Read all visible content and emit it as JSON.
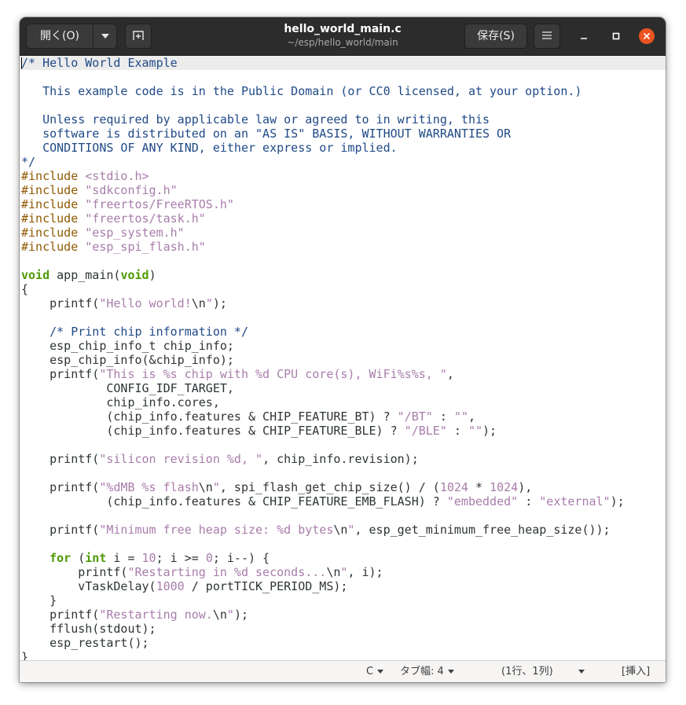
{
  "header": {
    "open_label": "開く(O)",
    "title": "hello_world_main.c",
    "subtitle": "~/esp/hello_world/main",
    "save_label": "保存(S)",
    "colors": {
      "bar": "#2c2c2c",
      "close": "#e95420"
    }
  },
  "editor": {
    "language_colors": {
      "comment": "#204a87",
      "preprocessor": "#8f5902",
      "string": "#a87dab",
      "keyword": "#4e9a06"
    },
    "lines": [
      "/* Hello World Example",
      "",
      "   This example code is in the Public Domain (or CC0 licensed, at your option.)",
      "",
      "   Unless required by applicable law or agreed to in writing, this",
      "   software is distributed on an \"AS IS\" BASIS, WITHOUT WARRANTIES OR",
      "   CONDITIONS OF ANY KIND, either express or implied.",
      "*/",
      "#include <stdio.h>",
      "#include \"sdkconfig.h\"",
      "#include \"freertos/FreeRTOS.h\"",
      "#include \"freertos/task.h\"",
      "#include \"esp_system.h\"",
      "#include \"esp_spi_flash.h\"",
      "",
      "void app_main(void)",
      "{",
      "    printf(\"Hello world!\\n\");",
      "",
      "    /* Print chip information */",
      "    esp_chip_info_t chip_info;",
      "    esp_chip_info(&chip_info);",
      "    printf(\"This is %s chip with %d CPU core(s), WiFi%s%s, \",",
      "            CONFIG_IDF_TARGET,",
      "            chip_info.cores,",
      "            (chip_info.features & CHIP_FEATURE_BT) ? \"/BT\" : \"\",",
      "            (chip_info.features & CHIP_FEATURE_BLE) ? \"/BLE\" : \"\");",
      "",
      "    printf(\"silicon revision %d, \", chip_info.revision);",
      "",
      "    printf(\"%dMB %s flash\\n\", spi_flash_get_chip_size() / (1024 * 1024),",
      "            (chip_info.features & CHIP_FEATURE_EMB_FLASH) ? \"embedded\" : \"external\");",
      "",
      "    printf(\"Minimum free heap size: %d bytes\\n\", esp_get_minimum_free_heap_size());",
      "",
      "    for (int i = 10; i >= 0; i--) {",
      "        printf(\"Restarting in %d seconds...\\n\", i);",
      "        vTaskDelay(1000 / portTICK_PERIOD_MS);",
      "    }",
      "    printf(\"Restarting now.\\n\");",
      "    fflush(stdout);",
      "    esp_restart();",
      "}"
    ]
  },
  "statusbar": {
    "language": "C",
    "tab_width": "タブ幅: 4",
    "position": "(1行、1列)",
    "mode": "[挿入]"
  }
}
